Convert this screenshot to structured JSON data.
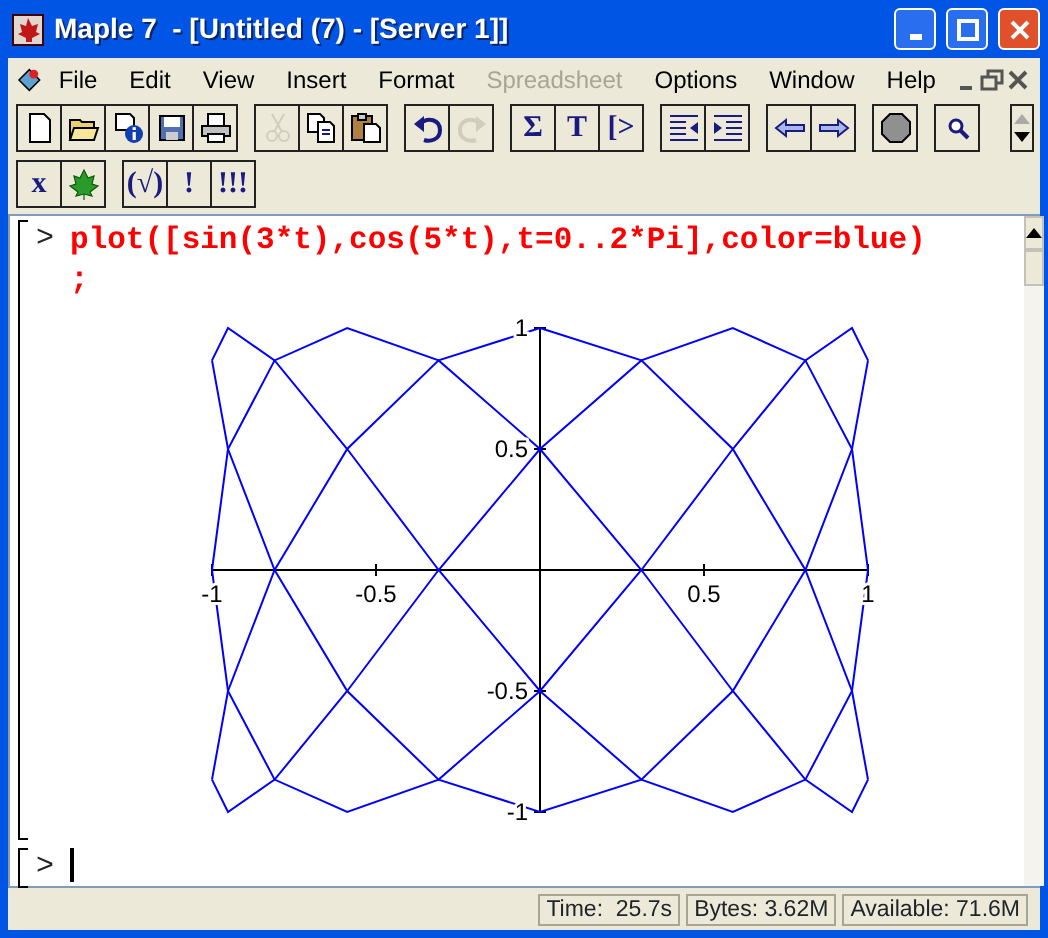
{
  "window": {
    "title": "Maple 7  - [Untitled (7) - [Server 1]]"
  },
  "menu": [
    {
      "label": "File",
      "disabled": false
    },
    {
      "label": "Edit",
      "disabled": false
    },
    {
      "label": "View",
      "disabled": false
    },
    {
      "label": "Insert",
      "disabled": false
    },
    {
      "label": "Format",
      "disabled": false
    },
    {
      "label": "Spreadsheet",
      "disabled": true
    },
    {
      "label": "Options",
      "disabled": false
    },
    {
      "label": "Window",
      "disabled": false
    },
    {
      "label": "Help",
      "disabled": false
    }
  ],
  "toolbars": [
    [
      [
        {
          "kind": "new",
          "disabled": false
        },
        {
          "kind": "open",
          "disabled": false
        },
        {
          "kind": "info",
          "disabled": false
        },
        {
          "kind": "save",
          "disabled": false
        },
        {
          "kind": "print",
          "disabled": false
        }
      ],
      [
        {
          "kind": "cut",
          "disabled": true
        },
        {
          "kind": "copy",
          "disabled": false
        },
        {
          "kind": "paste",
          "disabled": false
        }
      ],
      [
        {
          "kind": "undo",
          "disabled": false
        },
        {
          "kind": "redo",
          "disabled": true
        }
      ],
      [
        {
          "kind": "text",
          "label": "Σ",
          "disabled": false
        },
        {
          "kind": "text",
          "label": "T",
          "disabled": false
        },
        {
          "kind": "text",
          "label": "[>",
          "disabled": false
        }
      ],
      [
        {
          "kind": "outdent",
          "disabled": false
        },
        {
          "kind": "indent",
          "disabled": false
        }
      ],
      [
        {
          "kind": "back",
          "disabled": false
        },
        {
          "kind": "forward",
          "disabled": false
        }
      ],
      [
        {
          "kind": "stop",
          "disabled": false
        }
      ],
      [
        {
          "kind": "zoom",
          "disabled": false
        }
      ]
    ],
    [
      [
        {
          "kind": "text",
          "label": "x",
          "disabled": false
        },
        {
          "kind": "leaf",
          "disabled": false
        }
      ],
      [
        {
          "kind": "text",
          "label": "(√)",
          "disabled": false
        },
        {
          "kind": "text",
          "label": "!",
          "disabled": false
        },
        {
          "kind": "text",
          "label": "!!!",
          "disabled": false
        }
      ]
    ]
  ],
  "worksheet": [
    {
      "prompt": ">",
      "lines": [
        "plot([sin(3*t),cos(5*t),t=0..2*Pi],color=blue)",
        ";"
      ],
      "cursor": false,
      "chart_data": {
        "type": "line",
        "xlim": [
          -1,
          1
        ],
        "ylim": [
          -1,
          1
        ],
        "xticks": [
          -1,
          -0.5,
          0.5,
          1
        ],
        "yticks": [
          -1,
          -0.5,
          0.5,
          1
        ],
        "x": [
          0,
          0.309,
          0.588,
          0.809,
          0.951,
          1,
          0.951,
          0.809,
          0.588,
          0.309,
          0,
          -0.309,
          -0.588,
          -0.809,
          -0.951,
          -1,
          -0.951,
          -0.809,
          -0.588,
          -0.309,
          0,
          0.309,
          0.588,
          0.809,
          0.951,
          1,
          0.951,
          0.809,
          0.588,
          0.309,
          0,
          -0.309,
          -0.588,
          -0.809,
          -0.951,
          -1,
          -0.951,
          -0.809,
          -0.588,
          -0.309,
          0,
          0.309,
          0.588,
          0.809,
          0.951,
          1,
          0.951,
          0.809,
          0.588,
          0.309,
          0,
          -0.309,
          -0.588,
          -0.809,
          -0.951,
          -1,
          -0.951,
          -0.809,
          -0.588,
          -0.309,
          0
        ],
        "series": [
          {
            "color": "#0000ff",
            "values": [
              1,
              0.866,
              0.5,
              0,
              -0.5,
              -0.866,
              null,
              null,
              null,
              null,
              null,
              null,
              null,
              null,
              null,
              null,
              null,
              null,
              null,
              null,
              null,
              null,
              null,
              null,
              null,
              null,
              null,
              null,
              null,
              null,
              null,
              null,
              null,
              null,
              null,
              null,
              null,
              null,
              null,
              null,
              null,
              null,
              null,
              null,
              null,
              null,
              null,
              null,
              null,
              null,
              null,
              null,
              null,
              null,
              null,
              null,
              null,
              null,
              null,
              null,
              null
            ]
          },
          {
            "color": "#0000ff",
            "values": [
              null,
              null,
              null,
              null,
              null,
              -0.866,
              -1,
              -0.866,
              -0.5,
              0,
              0.5,
              0.866,
              1,
              0.866,
              0.5,
              0,
              null,
              null,
              null,
              null,
              null,
              null,
              null,
              null,
              null,
              null,
              null,
              null,
              null,
              null,
              null,
              null,
              null,
              null,
              null,
              null,
              null,
              null,
              null,
              null,
              null,
              null,
              null,
              null,
              null,
              null,
              null,
              null,
              null,
              null,
              null,
              null,
              null,
              null,
              null,
              null,
              null,
              null,
              null,
              null,
              null
            ]
          },
          {
            "color": "#0000ff",
            "values": [
              null,
              null,
              null,
              null,
              null,
              null,
              null,
              null,
              null,
              null,
              null,
              null,
              null,
              null,
              null,
              0,
              -0.5,
              -0.866,
              -1,
              -0.866,
              -0.5,
              0,
              0.5,
              0.866,
              1,
              0.866,
              null,
              null,
              null,
              null,
              null,
              null,
              null,
              null,
              null,
              null,
              null,
              null,
              null,
              null,
              null,
              null,
              null,
              null,
              null,
              null,
              null,
              null,
              null,
              null,
              null,
              null,
              null,
              null,
              null,
              null,
              null,
              null,
              null,
              null,
              null
            ]
          },
          {
            "color": "#0000ff",
            "values": [
              null,
              null,
              null,
              null,
              null,
              null,
              null,
              null,
              null,
              null,
              null,
              null,
              null,
              null,
              null,
              null,
              null,
              null,
              null,
              null,
              null,
              null,
              null,
              null,
              null,
              0.866,
              0.5,
              0,
              -0.5,
              -0.866,
              -1,
              -0.866,
              -0.5,
              0,
              0.5,
              0.866,
              null,
              null,
              null,
              null,
              null,
              null,
              null,
              null,
              null,
              null,
              null,
              null,
              null,
              null,
              null,
              null,
              null,
              null,
              null,
              null,
              null,
              null,
              null,
              null,
              null
            ]
          },
          {
            "color": "#0000ff",
            "values": [
              null,
              null,
              null,
              null,
              null,
              null,
              null,
              null,
              null,
              null,
              null,
              null,
              null,
              null,
              null,
              null,
              null,
              null,
              null,
              null,
              null,
              null,
              null,
              null,
              null,
              null,
              null,
              null,
              null,
              null,
              null,
              null,
              null,
              null,
              null,
              0.866,
              1,
              0.866,
              0.5,
              0,
              -0.5,
              -0.866,
              -1,
              -0.866,
              -0.5,
              0,
              null,
              null,
              null,
              null,
              null,
              null,
              null,
              null,
              null,
              null,
              null,
              null,
              null,
              null,
              null
            ]
          },
          {
            "color": "#0000ff",
            "values": [
              null,
              null,
              null,
              null,
              null,
              null,
              null,
              null,
              null,
              null,
              null,
              null,
              null,
              null,
              null,
              null,
              null,
              null,
              null,
              null,
              null,
              null,
              null,
              null,
              null,
              null,
              null,
              null,
              null,
              null,
              null,
              null,
              null,
              null,
              null,
              null,
              null,
              null,
              null,
              null,
              null,
              null,
              null,
              null,
              null,
              0,
              0.5,
              0.866,
              1,
              0.866,
              0.5,
              0,
              -0.5,
              -0.866,
              -1,
              -0.866,
              null,
              null,
              null,
              null,
              null
            ]
          },
          {
            "color": "#0000ff",
            "values": [
              null,
              null,
              null,
              null,
              null,
              null,
              null,
              null,
              null,
              null,
              null,
              null,
              null,
              null,
              null,
              null,
              null,
              null,
              null,
              null,
              null,
              null,
              null,
              null,
              null,
              null,
              null,
              null,
              null,
              null,
              null,
              null,
              null,
              null,
              null,
              null,
              null,
              null,
              null,
              null,
              null,
              null,
              null,
              null,
              null,
              null,
              null,
              null,
              null,
              null,
              null,
              null,
              null,
              null,
              null,
              -0.866,
              -0.5,
              0,
              0.5,
              0.866,
              1
            ]
          }
        ]
      }
    },
    {
      "prompt": ">",
      "cursor": true
    }
  ],
  "status_bar": [
    "Time:  25.7s",
    "Bytes: 3.62M",
    "Available: 71.6M"
  ]
}
